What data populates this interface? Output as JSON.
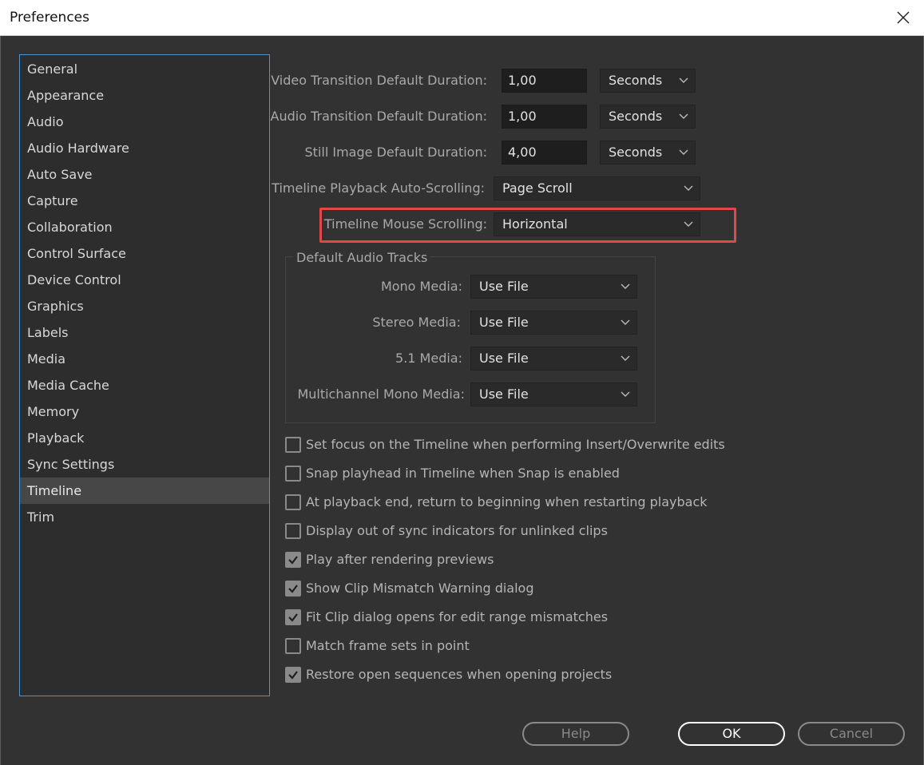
{
  "window": {
    "title": "Preferences"
  },
  "sidebar": {
    "items": [
      "General",
      "Appearance",
      "Audio",
      "Audio Hardware",
      "Auto Save",
      "Capture",
      "Collaboration",
      "Control Surface",
      "Device Control",
      "Graphics",
      "Labels",
      "Media",
      "Media Cache",
      "Memory",
      "Playback",
      "Sync Settings",
      "Timeline",
      "Trim"
    ],
    "selected": "Timeline"
  },
  "durations": {
    "video": {
      "label": "Video Transition Default Duration:",
      "value": "1,00",
      "unit": "Seconds"
    },
    "audio": {
      "label": "Audio Transition Default Duration:",
      "value": "1,00",
      "unit": "Seconds"
    },
    "still": {
      "label": "Still Image Default Duration:",
      "value": "4,00",
      "unit": "Seconds"
    }
  },
  "playback_scroll": {
    "label": "Timeline Playback Auto-Scrolling:",
    "value": "Page Scroll"
  },
  "mouse_scroll": {
    "label": "Timeline Mouse Scrolling:",
    "value": "Horizontal"
  },
  "audio_tracks": {
    "title": "Default Audio Tracks",
    "mono": {
      "label": "Mono Media:",
      "value": "Use File"
    },
    "stereo": {
      "label": "Stereo Media:",
      "value": "Use File"
    },
    "surround": {
      "label": "5.1 Media:",
      "value": "Use File"
    },
    "multichannel": {
      "label": "Multichannel Mono Media:",
      "value": "Use File"
    }
  },
  "checkboxes": [
    {
      "label": "Set focus on the Timeline when performing Insert/Overwrite edits",
      "checked": false
    },
    {
      "label": "Snap playhead in Timeline when Snap is enabled",
      "checked": false
    },
    {
      "label": "At playback end, return to beginning when restarting playback",
      "checked": false
    },
    {
      "label": "Display out of sync indicators for unlinked clips",
      "checked": false
    },
    {
      "label": "Play after rendering previews",
      "checked": true
    },
    {
      "label": "Show Clip Mismatch Warning dialog",
      "checked": true
    },
    {
      "label": "Fit Clip dialog opens for edit range mismatches",
      "checked": true
    },
    {
      "label": "Match frame sets in point",
      "checked": false
    },
    {
      "label": "Restore open sequences when opening projects",
      "checked": true
    }
  ],
  "buttons": {
    "help": "Help",
    "ok": "OK",
    "cancel": "Cancel"
  },
  "colors": {
    "highlight": "#e0484a",
    "sidebar_border": "#4c95d1",
    "background": "#323232"
  }
}
